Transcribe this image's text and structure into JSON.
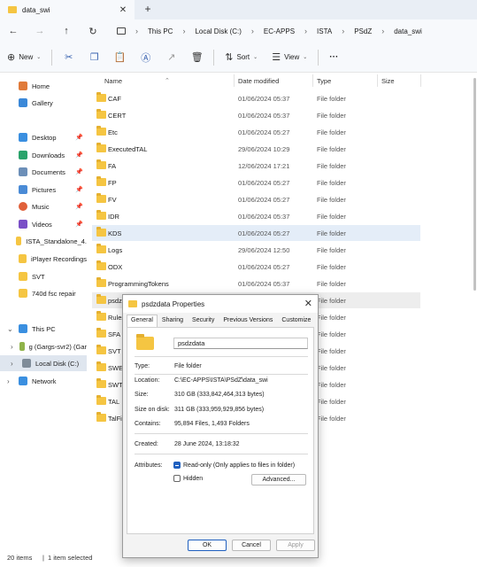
{
  "tab": {
    "title": "data_swi",
    "close": "✕",
    "new": "+"
  },
  "breadcrumb": [
    "This PC",
    "Local Disk (C:)",
    "EC-APPS",
    "ISTA",
    "PSdZ",
    "data_swi"
  ],
  "commandbar": {
    "new_label": "New",
    "sort_label": "Sort",
    "view_label": "View",
    "more": "···"
  },
  "sidebar": {
    "items": [
      {
        "label": "Home",
        "icon": "home-icon"
      },
      {
        "label": "Gallery",
        "icon": "gallery-icon"
      },
      {
        "label": "Desktop",
        "icon": "desktop-icon"
      },
      {
        "label": "Downloads",
        "icon": "downloads-icon"
      },
      {
        "label": "Documents",
        "icon": "documents-icon"
      },
      {
        "label": "Pictures",
        "icon": "pictures-icon"
      },
      {
        "label": "Music",
        "icon": "music-icon"
      },
      {
        "label": "Videos",
        "icon": "videos-icon"
      },
      {
        "label": "ISTA_Standalone_4.",
        "icon": "folder-icon"
      },
      {
        "label": "iPlayer Recordings",
        "icon": "folder-icon"
      },
      {
        "label": "SVT",
        "icon": "folder-icon"
      },
      {
        "label": "740d fsc repair",
        "icon": "folder-icon"
      },
      {
        "label": "This PC",
        "icon": "computer-icon"
      },
      {
        "label": "g (Gargs-svr2) (Gar",
        "icon": "network-drive-icon"
      },
      {
        "label": "Local Disk (C:)",
        "icon": "drive-icon"
      },
      {
        "label": "Network",
        "icon": "network-icon"
      }
    ]
  },
  "columns": {
    "name": "Name",
    "date": "Date modified",
    "type": "Type",
    "size": "Size"
  },
  "files": [
    {
      "name": "CAF",
      "date": "01/06/2024 05:37",
      "type": "File folder"
    },
    {
      "name": "CERT",
      "date": "01/06/2024 05:37",
      "type": "File folder"
    },
    {
      "name": "Etc",
      "date": "01/06/2024 05:27",
      "type": "File folder"
    },
    {
      "name": "ExecutedTAL",
      "date": "29/06/2024 10:29",
      "type": "File folder"
    },
    {
      "name": "FA",
      "date": "12/06/2024 17:21",
      "type": "File folder"
    },
    {
      "name": "FP",
      "date": "01/06/2024 05:27",
      "type": "File folder"
    },
    {
      "name": "FV",
      "date": "01/06/2024 05:27",
      "type": "File folder"
    },
    {
      "name": "IDR",
      "date": "01/06/2024 05:37",
      "type": "File folder"
    },
    {
      "name": "KDS",
      "date": "01/06/2024 05:27",
      "type": "File folder"
    },
    {
      "name": "Logs",
      "date": "29/06/2024 12:50",
      "type": "File folder"
    },
    {
      "name": "ODX",
      "date": "01/06/2024 05:27",
      "type": "File folder"
    },
    {
      "name": "ProgrammingTokens",
      "date": "01/06/2024 05:37",
      "type": "File folder"
    },
    {
      "name": "psdz",
      "date": "",
      "type": "File folder"
    },
    {
      "name": "Rules",
      "date": "",
      "type": "File folder"
    },
    {
      "name": "SFA",
      "date": "",
      "type": "File folder"
    },
    {
      "name": "SVT",
      "date": "",
      "type": "File folder"
    },
    {
      "name": "SWE",
      "date": "",
      "type": "File folder"
    },
    {
      "name": "SWT",
      "date": "",
      "type": "File folder"
    },
    {
      "name": "TAL",
      "date": "",
      "type": "File folder"
    },
    {
      "name": "TalFil",
      "date": "",
      "type": "File folder"
    }
  ],
  "status": {
    "count": "20 items",
    "selected": "1 item selected"
  },
  "dialog": {
    "title": "psdzdata Properties",
    "close": "✕",
    "tabs": [
      "General",
      "Sharing",
      "Security",
      "Previous Versions",
      "Customize"
    ],
    "name": "psdzdata",
    "type_label": "Type:",
    "type_value": "File folder",
    "location_label": "Location:",
    "location_value": "C:\\EC-APPS\\ISTA\\PSdZ\\data_swi",
    "size_label": "Size:",
    "size_value": "310 GB (333,842,464,313 bytes)",
    "sizeondisk_label": "Size on disk:",
    "sizeondisk_value": "311 GB (333,959,929,856 bytes)",
    "contains_label": "Contains:",
    "contains_value": "95,894 Files, 1,493 Folders",
    "created_label": "Created:",
    "created_value": "28 June 2024, 13:18:32",
    "attributes_label": "Attributes:",
    "readonly_label": "Read-only (Only applies to files in folder)",
    "hidden_label": "Hidden",
    "advanced_label": "Advanced...",
    "ok_label": "OK",
    "cancel_label": "Cancel",
    "apply_label": "Apply"
  }
}
